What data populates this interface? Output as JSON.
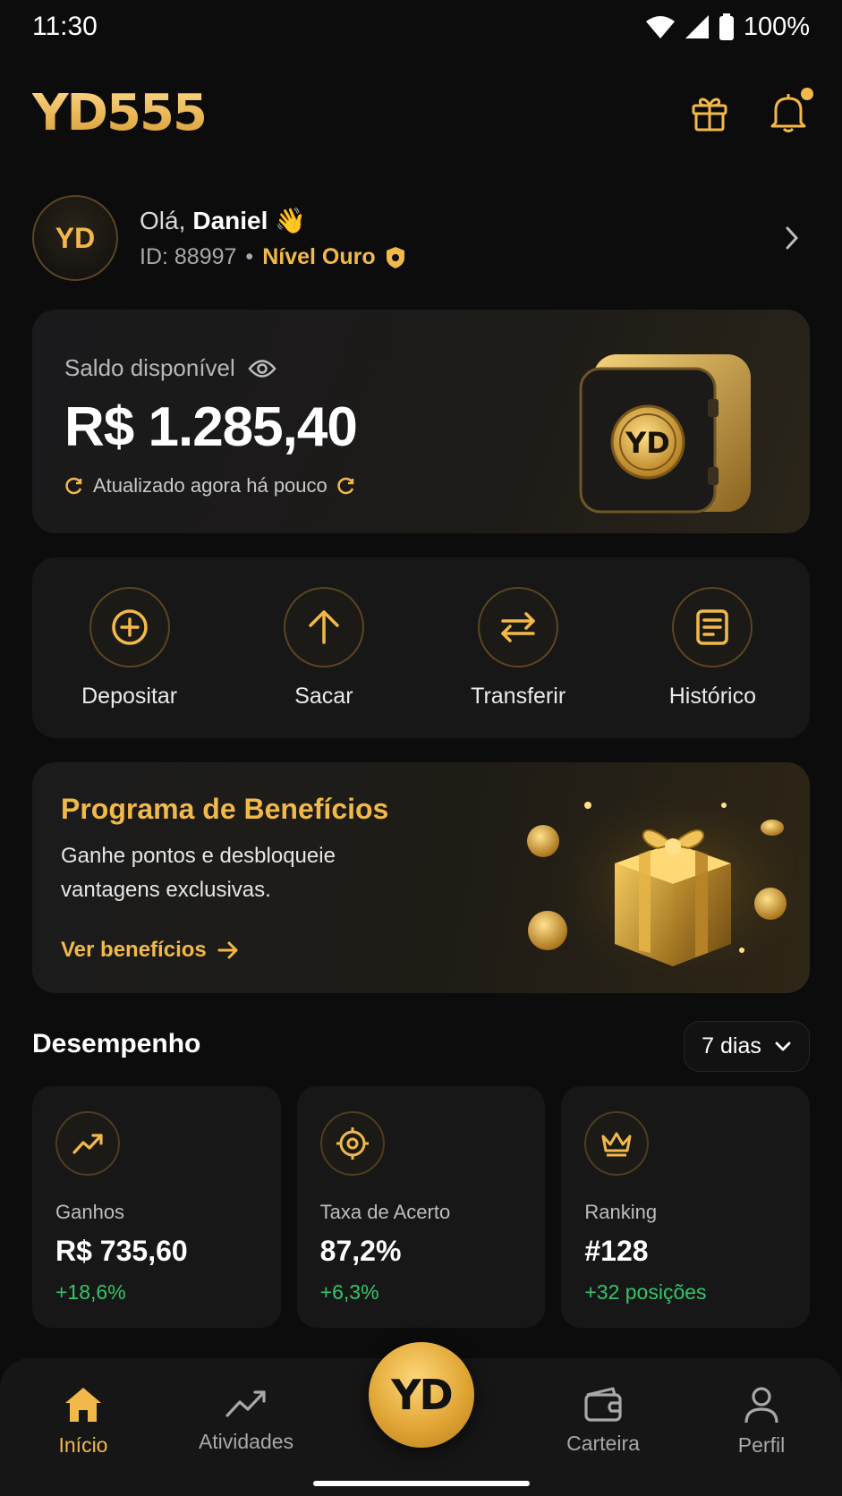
{
  "status_bar": {
    "time": "11:30",
    "battery": "100%"
  },
  "header": {
    "logo": "YD555",
    "gift_icon": "gift-icon",
    "bell_icon": "bell-icon"
  },
  "profile": {
    "avatar_initials": "YD",
    "greeting": "Olá,",
    "name": "Daniel",
    "wave_emoji": "👋",
    "id_text": "ID: 88997",
    "separator": "•",
    "level": "Nível Ouro"
  },
  "balance": {
    "label": "Saldo disponível",
    "value": "R$ 1.285,40",
    "updated": "Atualizado agora há pouco",
    "safe_logo": "YD"
  },
  "actions": [
    {
      "label": "Depositar",
      "icon": "plus-circle-icon"
    },
    {
      "label": "Sacar",
      "icon": "arrow-up-icon"
    },
    {
      "label": "Transferir",
      "icon": "transfer-icon"
    },
    {
      "label": "Histórico",
      "icon": "receipt-icon"
    }
  ],
  "benefits": {
    "title": "Programa de Benefícios",
    "description": "Ganhe pontos e desbloqueie vantagens exclusivas.",
    "link": "Ver benefícios"
  },
  "performance": {
    "title": "Desempenho",
    "period": "7 dias",
    "stats": [
      {
        "label": "Ganhos",
        "value": "R$ 735,60",
        "delta": "+18,6%",
        "icon": "trending-up-icon"
      },
      {
        "label": "Taxa de Acerto",
        "value": "87,2%",
        "delta": "+6,3%",
        "icon": "target-icon"
      },
      {
        "label": "Ranking",
        "value": "#128",
        "delta": "+32 posições",
        "icon": "crown-icon"
      }
    ]
  },
  "bottom_nav": {
    "items": [
      {
        "label": "Início",
        "icon": "home-icon",
        "active": true
      },
      {
        "label": "Atividades",
        "icon": "activity-chart-icon",
        "active": false
      },
      {
        "label": "Carteira",
        "icon": "wallet-icon",
        "active": false
      },
      {
        "label": "Perfil",
        "icon": "user-icon",
        "active": false
      }
    ],
    "center_label": "YD"
  },
  "colors": {
    "accent": "#f2b94a",
    "positive": "#35c46a",
    "background": "#0c0c0d",
    "card": "#171718"
  }
}
